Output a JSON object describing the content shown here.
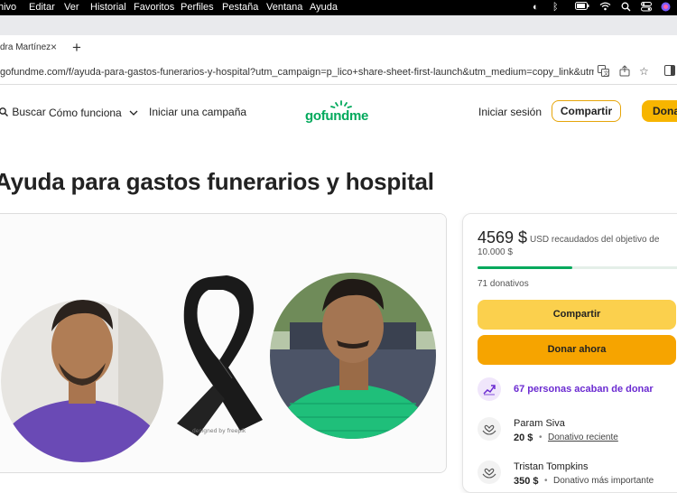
{
  "menubar": {
    "items": [
      "hivo",
      "Editar",
      "Ver",
      "Historial",
      "Favoritos",
      "Perfiles",
      "Pestaña",
      "Ventana",
      "Ayuda"
    ]
  },
  "browser": {
    "tab_title": "dra Martínez",
    "tab_close": "×",
    "new_tab": "+",
    "url": "gofundme.com/f/ayuda-para-gastos-funerarios-y-hospital?utm_campaign=p_lico+share-sheet-first-launch&utm_medium=copy_link&utm_s..."
  },
  "header": {
    "search_label": "Buscar",
    "how_it_works_label": "Cómo funciona",
    "start_campaign_label": "Iniciar una campaña",
    "logo_text": "gofundme",
    "login_label": "Iniciar sesión",
    "share_label": "Compartir",
    "donate_label": "Dona"
  },
  "page": {
    "title": "Ayuda para gastos funerarios y hospital"
  },
  "hero": {
    "watermark": "designed by freepik"
  },
  "donation": {
    "raised": "4569 $",
    "raised_desc": "USD recaudados del objetivo de 10.000 $",
    "progress": 0.4569,
    "count": "71 donativos",
    "share_label": "Compartir",
    "donate_label": "Donar ahora",
    "recent_text": "67 personas acaban de donar",
    "donors": [
      {
        "name": "Param Siva",
        "amount": "20 $",
        "tag": "Donativo reciente"
      },
      {
        "name": "Tristan Tompkins",
        "amount": "350 $",
        "tag": "Donativo más importante"
      }
    ]
  },
  "colors": {
    "brand_green": "#02a95c",
    "share_yellow": "#fbd04d",
    "donate_orange": "#f6a400",
    "purple": "#6b2bd1"
  }
}
